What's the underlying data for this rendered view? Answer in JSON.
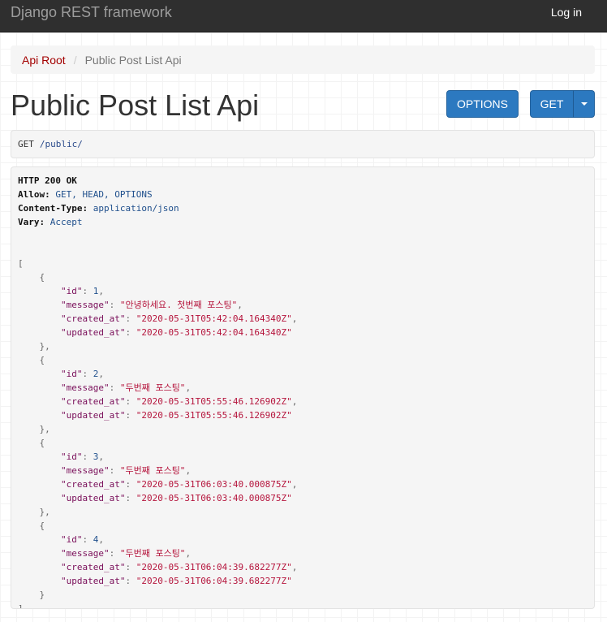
{
  "navbar": {
    "brand": "Django REST framework",
    "login": "Log in"
  },
  "breadcrumb": {
    "root": "Api Root",
    "separator": "/",
    "current": "Public Post List Api"
  },
  "page": {
    "title": "Public Post List Api"
  },
  "buttons": {
    "options": "OPTIONS",
    "get": "GET"
  },
  "request": {
    "method": "GET",
    "path": "/public/"
  },
  "response": {
    "status_line": "HTTP 200 OK",
    "headers": [
      {
        "key": "Allow:",
        "value": "GET, HEAD, OPTIONS"
      },
      {
        "key": "Content-Type:",
        "value": "application/json"
      },
      {
        "key": "Vary:",
        "value": "Accept"
      }
    ],
    "items": [
      {
        "id": 1,
        "message": "안녕하세요. 첫번째 포스팅",
        "created_at": "2020-05-31T05:42:04.164340Z",
        "updated_at": "2020-05-31T05:42:04.164340Z"
      },
      {
        "id": 2,
        "message": "두번째 포스팅",
        "created_at": "2020-05-31T05:55:46.126902Z",
        "updated_at": "2020-05-31T05:55:46.126902Z"
      },
      {
        "id": 3,
        "message": "두번째 포스팅",
        "created_at": "2020-05-31T06:03:40.000875Z",
        "updated_at": "2020-05-31T06:03:40.000875Z"
      },
      {
        "id": 4,
        "message": "두번째 포스팅",
        "created_at": "2020-05-31T06:04:39.682277Z",
        "updated_at": "2020-05-31T06:04:39.682277Z"
      }
    ]
  },
  "colors": {
    "navbar_bg": "#2f2f2f",
    "button_primary": "#2c79c0",
    "link_red": "#a30000",
    "json_string": "#b5143c"
  },
  "icons": {
    "dropdown": "caret-down-icon"
  }
}
